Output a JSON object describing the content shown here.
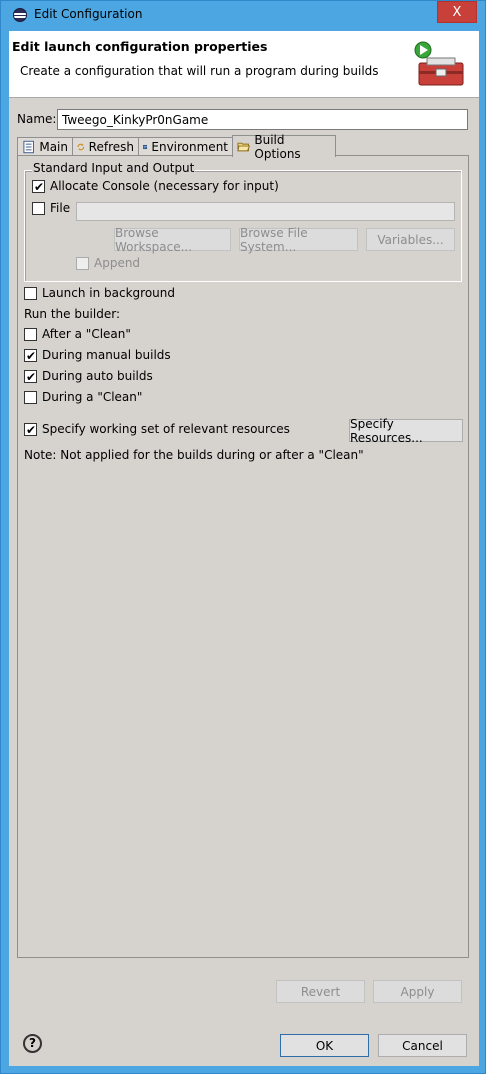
{
  "window": {
    "title": "Edit Configuration",
    "close_label": "X"
  },
  "header": {
    "title": "Edit launch configuration properties",
    "description": "Create a configuration that will run a program during builds"
  },
  "name_field": {
    "label": "Name:",
    "value": "Tweego_KinkyPr0nGame"
  },
  "tabs": [
    {
      "label": "Main",
      "icon": "document-icon"
    },
    {
      "label": "Refresh",
      "icon": "refresh-icon"
    },
    {
      "label": "Environment",
      "icon": "environment-icon"
    },
    {
      "label": "Build Options",
      "icon": "folder-open-icon",
      "active": true
    }
  ],
  "standard_io": {
    "group_label": "Standard Input and Output",
    "allocate_console": {
      "label": "Allocate Console (necessary for input)",
      "checked": true
    },
    "file": {
      "label": "File",
      "checked": false,
      "value": ""
    },
    "browse_workspace_label": "Browse Workspace...",
    "browse_file_system_label": "Browse File System...",
    "variables_label": "Variables...",
    "append": {
      "label": "Append",
      "checked": false,
      "enabled": false
    }
  },
  "options": {
    "launch_background": {
      "label": "Launch in background",
      "checked": false
    },
    "run_builder_label": "Run the builder:",
    "after_clean": {
      "label": "After a \"Clean\"",
      "checked": false
    },
    "manual_builds": {
      "label": "During manual builds",
      "checked": true
    },
    "auto_builds": {
      "label": "During auto builds",
      "checked": true
    },
    "during_clean": {
      "label": "During a \"Clean\"",
      "checked": false
    },
    "working_set": {
      "label": "Specify working set of relevant resources",
      "checked": true
    },
    "specify_resources_label": "Specify Resources...",
    "note": "Note: Not applied for the builds during or after a \"Clean\""
  },
  "footer": {
    "revert_label": "Revert",
    "apply_label": "Apply",
    "ok_label": "OK",
    "cancel_label": "Cancel",
    "help_label": "?"
  }
}
